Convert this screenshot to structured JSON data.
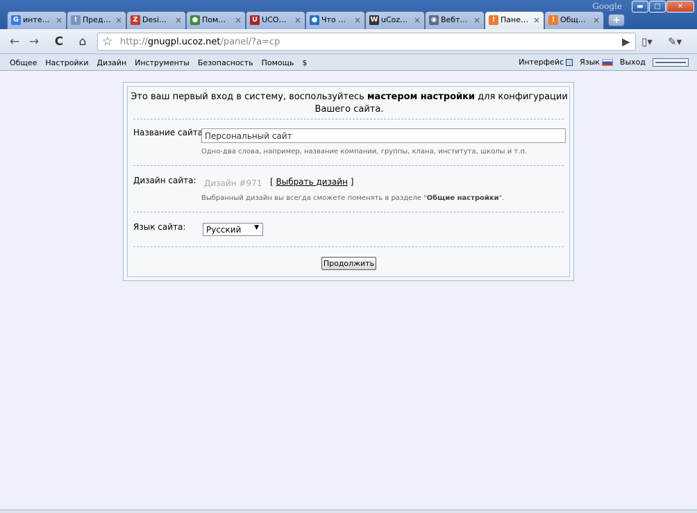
{
  "window": {
    "brand": "Google",
    "minimize": "▬",
    "maximize": "□",
    "close": "✕"
  },
  "tabs": [
    {
      "title": "инте…",
      "favicon_text": "G",
      "favicon_color": "#3b78e7"
    },
    {
      "title": "Пред…",
      "favicon_text": "!",
      "favicon_color": "#7d93c2"
    },
    {
      "title": "Desi…",
      "favicon_text": "Z",
      "favicon_color": "#c73a2f"
    },
    {
      "title": "Пом…",
      "favicon_text": "●",
      "favicon_color": "#3a8a3a"
    },
    {
      "title": "UCO…",
      "favicon_text": "U",
      "favicon_color": "#b02222"
    },
    {
      "title": "Что …",
      "favicon_text": "●",
      "favicon_color": "#1f74c8"
    },
    {
      "title": "uCoz…",
      "favicon_text": "W",
      "favicon_color": "#333333"
    },
    {
      "title": "Вебт…",
      "favicon_text": "◉",
      "favicon_color": "#5a6b8c"
    },
    {
      "title": "Пане…",
      "favicon_text": "!",
      "favicon_color": "#f07a2a",
      "active": true
    },
    {
      "title": "Общ…",
      "favicon_text": "!",
      "favicon_color": "#f07a2a"
    }
  ],
  "newtab": "+",
  "toolbar": {
    "back": "←",
    "forward": "→",
    "reload": "C",
    "home": "⌂",
    "star": "☆",
    "url_scheme": "http://",
    "url_host": "gnugpl.ucoz.net",
    "url_path": "/panel/?a=cp",
    "go": "▶",
    "page_menu": "▯▾",
    "tools_menu": "✎▾"
  },
  "panel_menu": {
    "items": [
      "Общее",
      "Настройки",
      "Дизайн",
      "Инструменты",
      "Безопасность",
      "Помощь",
      "$"
    ],
    "interface": "Интерфейс",
    "language": "Язык",
    "logout": "Выход"
  },
  "wizard": {
    "intro_before": "Это ваш первый вход в систему, воспользуйтесь ",
    "intro_bold": "мастером настройки",
    "intro_after": " для конфигурации Вашего сайта.",
    "site_name_label": "Название сайта:",
    "site_name_value": "Персональный сайт",
    "site_name_hint": "Одно-два слова, например, название компании, группы, клана, института, школы и т.п.",
    "design_label": "Дизайн сайта:",
    "design_value": "Дизайн #971",
    "choose_open": "[",
    "choose_link": "Выбрать дизайн",
    "choose_close": "]",
    "design_hint_before": "Выбранный дизайн вы всегда сможете поменять в разделе \"",
    "design_hint_bold": "Общие настройки",
    "design_hint_after": "\".",
    "lang_label": "Язык сайта:",
    "lang_value": "Русский",
    "continue_label": "Продолжить"
  }
}
